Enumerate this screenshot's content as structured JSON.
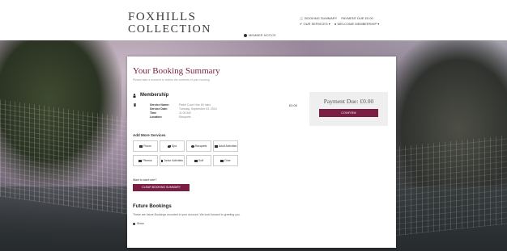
{
  "brand": {
    "line1": "FOXHILLS",
    "line2": "COLLECTION"
  },
  "header": {
    "booking_summary": "BOOKING SUMMARY",
    "payment_due": "PAYMENT DUE £0.00",
    "our_services": "OUR SERVICES",
    "welcome": "WELCOME MEMBERSHIP",
    "member_notice": "MEMBER NOTICE"
  },
  "summary": {
    "title": "Your Booking Summary",
    "subtitle": "Please take a moment to review the contents of your booking"
  },
  "membership": {
    "heading": "Membership",
    "rows": [
      {
        "label": "Service Name:",
        "value": "Padel Court Hire 60 mins"
      },
      {
        "label": "Service Date:",
        "value": "Tuesday, September 03, 2024"
      },
      {
        "label": "Time",
        "value": "11:00 AM"
      },
      {
        "label": "Location",
        "value": "Racquets"
      }
    ],
    "price": "£0.00"
  },
  "payment": {
    "due_label": "Payment Due: £0.00",
    "confirm": "CONFIRM"
  },
  "add_services": {
    "title": "Add More Services",
    "items": [
      {
        "label": "Room",
        "icon": "bed-icon"
      },
      {
        "label": "Spa",
        "icon": "leaf-icon"
      },
      {
        "label": "Racquets",
        "icon": "racquet-icon"
      },
      {
        "label": "Adult Activities",
        "icon": "people-icon"
      },
      {
        "label": "Fitness",
        "icon": "fitness-icon"
      },
      {
        "label": "Junior Activities",
        "icon": "junior-icon"
      },
      {
        "label": "Golf",
        "icon": "golf-flag-icon"
      },
      {
        "label": "Dine",
        "icon": "dine-icon"
      }
    ]
  },
  "start_over": {
    "question": "Want to start over?",
    "clear": "CLEAR BOOKING SUMMARY"
  },
  "future": {
    "title": "Future Bookings",
    "desc": "These are future Bookings recorded in your account. We look forward to greeting you.",
    "show": "Show"
  }
}
